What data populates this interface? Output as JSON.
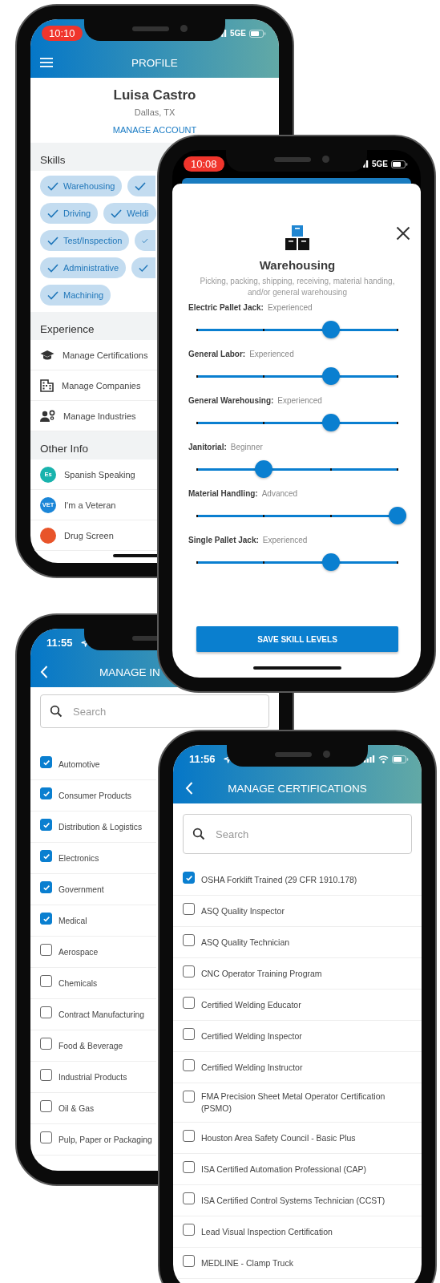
{
  "profile_screen": {
    "status": {
      "time": "10:10",
      "alert": true,
      "network": "5GE"
    },
    "title": "PROFILE",
    "name": "Luisa Castro",
    "location": "Dallas, TX",
    "account_link": "MANAGE ACCOUNT",
    "skills": {
      "title": "Skills",
      "rows": [
        {
          "chips": [
            {
              "label": "Warehousing",
              "checked": true
            },
            {
              "checked": true
            }
          ]
        },
        {
          "chips": [
            {
              "label": "Driving",
              "checked": true
            },
            {
              "label": "Weldi",
              "checked": true
            }
          ]
        },
        {
          "chips": [
            {
              "label": "Test/Inspection",
              "checked": true
            },
            {
              "checked": true
            }
          ]
        },
        {
          "chips": [
            {
              "label": "Administrative",
              "checked": true
            },
            {
              "checked": true
            }
          ]
        },
        {
          "chips": [
            {
              "label": "Machining",
              "checked": true
            }
          ]
        }
      ]
    },
    "experience": {
      "title": "Experience",
      "items": [
        {
          "label": "Manage Certifications"
        },
        {
          "label": "Manage Companies"
        },
        {
          "label": "Manage Industries"
        }
      ]
    },
    "other_info": {
      "title": "Other Info",
      "items": [
        {
          "label": "Spanish Speaking",
          "badge": "Es",
          "color": "#19b3ad"
        },
        {
          "label": "I'm a Veteran",
          "badge": "VET",
          "color": "#1b86d8"
        },
        {
          "label": "Drug Screen",
          "color": "#e8542a"
        }
      ]
    }
  },
  "skill_modal": {
    "status": {
      "time": "10:08",
      "alert": true,
      "network": "5GE"
    },
    "title": "Warehousing",
    "description": "Picking, packing, shipping, receiving, material handing, and/or general warehousing",
    "skills": [
      {
        "name": "Electric Pallet Jack:",
        "reading": "Experienced",
        "level": 0.667
      },
      {
        "name": "General Labor:",
        "reading": "Experienced",
        "level": 0.667
      },
      {
        "name": "General Warehousing:",
        "reading": "Experienced",
        "level": 0.667
      },
      {
        "name": "Janitorial:",
        "reading": "Beginner",
        "level": 0.333
      },
      {
        "name": "Material Handling:",
        "reading": "Advanced",
        "level": 1
      },
      {
        "name": "Single Pallet Jack:",
        "reading": "Experienced",
        "level": 0.667
      }
    ],
    "save_button": "SAVE SKILL LEVELS"
  },
  "industries_screen": {
    "status": {
      "time": "11:55",
      "alert": false,
      "location": true
    },
    "title": "MANAGE IN",
    "search": {
      "placeholder": "Search"
    },
    "items": [
      {
        "label": "Automotive",
        "checked": true
      },
      {
        "label": "Consumer Products",
        "checked": true
      },
      {
        "label": "Distribution & Logistics",
        "checked": true
      },
      {
        "label": "Electronics",
        "checked": true
      },
      {
        "label": "Government",
        "checked": true
      },
      {
        "label": "Medical",
        "checked": true
      },
      {
        "label": "Aerospace",
        "checked": false
      },
      {
        "label": "Chemicals",
        "checked": false
      },
      {
        "label": "Contract Manufacturing",
        "checked": false
      },
      {
        "label": "Food & Beverage",
        "checked": false
      },
      {
        "label": "Industrial Products",
        "checked": false
      },
      {
        "label": "Oil & Gas",
        "checked": false
      },
      {
        "label": "Pulp, Paper or Packaging",
        "checked": false
      }
    ]
  },
  "certifications_screen": {
    "status": {
      "time": "11:56",
      "alert": false,
      "location": true,
      "wifi": true
    },
    "title": "MANAGE CERTIFICATIONS",
    "search": {
      "placeholder": "Search"
    },
    "items": [
      {
        "label": "OSHA Forklift Trained (29 CFR 1910.178)",
        "checked": true
      },
      {
        "label": "ASQ Quality Inspector",
        "checked": false
      },
      {
        "label": "ASQ Quality Technician",
        "checked": false
      },
      {
        "label": "CNC Operator Training Program",
        "checked": false
      },
      {
        "label": "Certified Welding Educator",
        "checked": false
      },
      {
        "label": "Certified Welding Inspector",
        "checked": false
      },
      {
        "label": "Certified Welding Instructor",
        "checked": false
      },
      {
        "label": "FMA Precision Sheet Metal Operator Certification (PSMO)",
        "checked": false
      },
      {
        "label": "Houston Area Safety Council - Basic Plus",
        "checked": false
      },
      {
        "label": "ISA Certified Automation Professional (CAP)",
        "checked": false
      },
      {
        "label": "ISA Certified Control Systems Technician (CCST)",
        "checked": false
      },
      {
        "label": "Lead Visual Inspection Certification",
        "checked": false
      },
      {
        "label": "MEDLINE - Clamp Truck",
        "checked": false
      }
    ]
  }
}
